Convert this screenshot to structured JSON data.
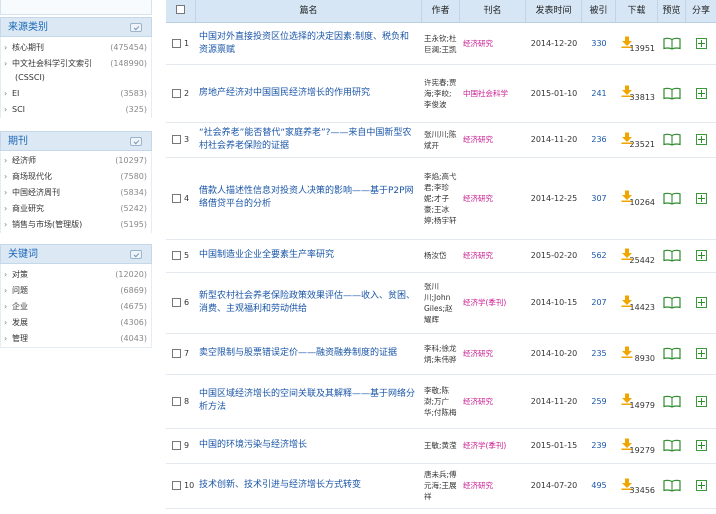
{
  "sidebar": {
    "top_cut": "",
    "sections": [
      {
        "title": "来源类别",
        "items": [
          {
            "label": "核心期刊",
            "count": "(475454)"
          },
          {
            "label": "中文社会科学引文索引",
            "count": "(148990)",
            "sub": "(CSSCI)"
          },
          {
            "label": "EI",
            "count": "(3583)"
          },
          {
            "label": "SCI",
            "count": "(325)"
          }
        ]
      },
      {
        "title": "期刊",
        "items": [
          {
            "label": "经济师",
            "count": "(10297)"
          },
          {
            "label": "商场现代化",
            "count": "(7580)"
          },
          {
            "label": "中国经济周刊",
            "count": "(5834)"
          },
          {
            "label": "商业研究",
            "count": "(5242)"
          },
          {
            "label": "销售与市场(管理版)",
            "count": "(5195)"
          }
        ]
      },
      {
        "title": "关键词",
        "items": [
          {
            "label": "对策",
            "count": "(12020)"
          },
          {
            "label": "问题",
            "count": "(6869)"
          },
          {
            "label": "企业",
            "count": "(4675)"
          },
          {
            "label": "发展",
            "count": "(4306)"
          },
          {
            "label": "管理",
            "count": "(4043)"
          }
        ]
      }
    ]
  },
  "table": {
    "headers": {
      "title": "篇名",
      "author": "作者",
      "pub": "刊名",
      "date": "发表时间",
      "cite": "被引",
      "download": "下载",
      "preview": "预览",
      "share": "分享"
    },
    "rows": [
      {
        "num": "1",
        "title": "中国对外直接投资区位选择的决定因素:制度、税负和资源禀赋",
        "author": "王永钦;杜巨澜;王凯",
        "pub": "经济研究",
        "date": "2014-12-20",
        "cite": "330",
        "downloads": "13951"
      },
      {
        "num": "2",
        "title": "房地产经济对中国国民经济增长的作用研究",
        "author": "许宪春;贾海;李皎;李俊波",
        "pub": "中国社会科学",
        "date": "2015-01-10",
        "cite": "241",
        "downloads": "33813"
      },
      {
        "num": "3",
        "title": "“社会养老”能否替代“家庭养老”?——来自中国新型农村社会养老保险的证据",
        "author": "张川川;陈斌开",
        "pub": "经济研究",
        "date": "2014-11-20",
        "cite": "236",
        "downloads": "23521"
      },
      {
        "num": "4",
        "title": "借款人描述性信息对投资人决策的影响——基于P2P网络借贷平台的分析",
        "author": "李焰;高弋君;李珍妮;才子豪;王冰婷;杨宇轩",
        "pub": "经济研究",
        "date": "2014-12-25",
        "cite": "307",
        "downloads": "10264"
      },
      {
        "num": "5",
        "title": "中国制造业企业全要素生产率研究",
        "author": "杨汝岱",
        "pub": "经济研究",
        "date": "2015-02-20",
        "cite": "562",
        "downloads": "25442"
      },
      {
        "num": "6",
        "title": "新型农村社会养老保险政策效果评估——收入、贫困、消费、主观福利和劳动供给",
        "author": "张川川;John Giles;赵耀辉",
        "pub": "经济学(季刊)",
        "date": "2014-10-15",
        "cite": "207",
        "downloads": "14423"
      },
      {
        "num": "7",
        "title": "卖空限制与股票错误定价——融资融券制度的证据",
        "author": "李科;徐龙炳;朱伟骅",
        "pub": "经济研究",
        "date": "2014-10-20",
        "cite": "235",
        "downloads": "8930"
      },
      {
        "num": "8",
        "title": "中国区域经济增长的空间关联及其解释——基于网络分析方法",
        "author": "李敬;陈澍;万广华;付陈梅",
        "pub": "经济研究",
        "date": "2014-11-20",
        "cite": "259",
        "downloads": "14979"
      },
      {
        "num": "9",
        "title": "中国的环境污染与经济增长",
        "author": "王敏;黄滢",
        "pub": "经济学(季刊)",
        "date": "2015-01-15",
        "cite": "239",
        "downloads": "19279"
      },
      {
        "num": "10",
        "title": "技术创新、技术引进与经济增长方式转变",
        "author": "唐未兵;傅元海;王展祥",
        "pub": "经济研究",
        "date": "2014-07-20",
        "cite": "495",
        "downloads": "33456"
      }
    ]
  },
  "colors": {
    "link": "#1a56a8",
    "journal": "#c9188f",
    "header_bg": "#d6e6f5",
    "section_title": "#1a67b8",
    "download_icon": "#f0a500",
    "action_green": "#2e8b2e"
  }
}
